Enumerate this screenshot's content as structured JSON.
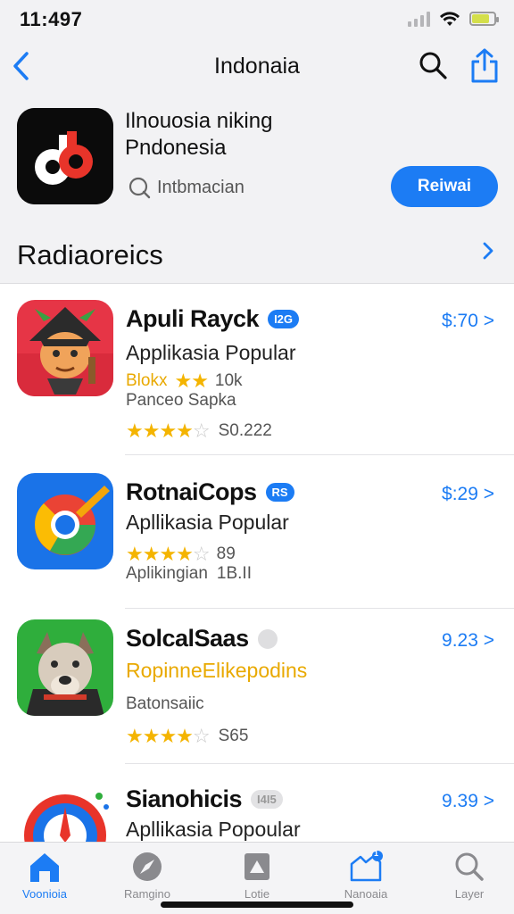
{
  "status_bar": {
    "time": "11:49",
    "time_suffix": "7"
  },
  "nav": {
    "title": "Indonaia",
    "back_icon": "chevron-left-icon",
    "search_icon": "search-icon",
    "share_icon": "share-icon"
  },
  "header_app": {
    "title_line1": "Ilnouosia niking",
    "title_line2": "Pndonesia",
    "subtitle": "Intbmacian",
    "install_label": "Reiwai"
  },
  "section": {
    "title": "Radiaoreics"
  },
  "apps": [
    {
      "name": "Apuli Rayck",
      "badge": "I2G",
      "subtitle": "Applikasia Popular",
      "line3_a": "Blokx",
      "line3_b": "10k",
      "line4_label": "Panceo Sapka",
      "rating_count": "S0.222",
      "price": "$:70 >"
    },
    {
      "name": "RotnaiCops",
      "badge": "RS",
      "subtitle": "Apllikasia Popular",
      "line3_b": "89",
      "line4_a": "Aplikingian",
      "line4_b": "1B.II",
      "price": "$:29 >"
    },
    {
      "name": "SolcalSaas",
      "subtitle": "RopinneElikepodins",
      "line3": "Batonsaiic",
      "rating_count": "S65",
      "price": "9.23 >"
    },
    {
      "name": "Sianohicis",
      "badge": "I4I5",
      "subtitle": "Apllikasia Popoular",
      "price": "9.39 >"
    }
  ],
  "tabs": [
    {
      "label": "Voonioia",
      "icon": "home-icon",
      "active": true
    },
    {
      "label": "Ramgino",
      "icon": "compass-icon",
      "active": false
    },
    {
      "label": "Lotie",
      "icon": "game-icon",
      "active": false
    },
    {
      "label": "Nanoaia",
      "icon": "apps-icon",
      "active": false,
      "badge": "1"
    },
    {
      "label": "Layer",
      "icon": "search-icon",
      "active": false
    }
  ],
  "colors": {
    "accent": "#1c7cf4",
    "star": "#f4b400",
    "background": "#f2f2f4"
  }
}
